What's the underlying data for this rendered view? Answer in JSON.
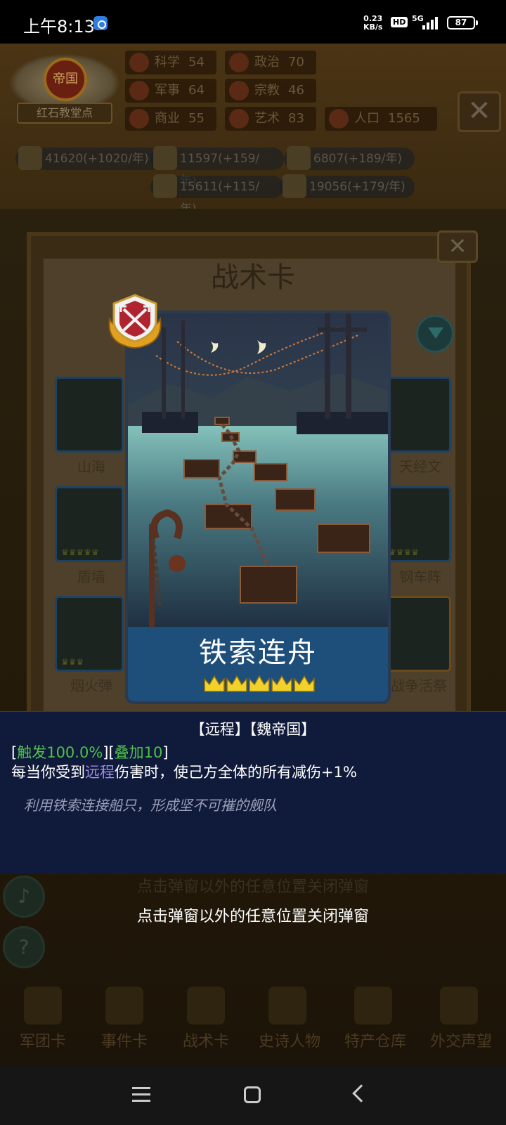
{
  "status_bar": {
    "time": "上午8:13",
    "net_speed_value": "0.23",
    "net_speed_unit": "KB/s",
    "hd_label": "HD",
    "network_label": "5G",
    "battery": "87"
  },
  "empire": {
    "emblem_text": "帝国",
    "name": "红石教堂点"
  },
  "stats": [
    {
      "icon": "science-icon",
      "label": "科学",
      "value": "54"
    },
    {
      "icon": "politics-icon",
      "label": "政治",
      "value": "70"
    },
    {
      "icon": "military-icon",
      "label": "军事",
      "value": "64"
    },
    {
      "icon": "religion-icon",
      "label": "宗教",
      "value": "46"
    },
    {
      "icon": "commerce-icon",
      "label": "商业",
      "value": "55"
    },
    {
      "icon": "art-icon",
      "label": "艺术",
      "value": "83"
    },
    {
      "icon": "population-icon",
      "label": "人口",
      "value": "1565"
    }
  ],
  "resources": [
    {
      "icon": "gold-icon",
      "text": "41620(+1020/年)"
    },
    {
      "icon": "wood-icon",
      "text": "11597(+159/年)"
    },
    {
      "icon": "iron-icon",
      "text": "6807(+189/年)"
    },
    {
      "icon": "stone-icon",
      "text": "15611(+115/年)"
    },
    {
      "icon": "meat-icon",
      "text": "19056(+179/年)"
    }
  ],
  "panel": {
    "title": "战术卡",
    "cards": [
      "山海",
      "天经文",
      "盾墙",
      "钢车阵",
      "烟火弹",
      "战争活祭"
    ]
  },
  "tooltip": {
    "tags": "【远程】【魏帝国】",
    "trigger_open": "[",
    "trigger": "触发100.0%",
    "mid": "][",
    "stack": "叠加10",
    "trigger_close": "]",
    "effect_pre": "每当你受到",
    "effect_keyword": "远程",
    "effect_post": "伤害时，使己方全体的所有减伤+1%",
    "flavor": "利用铁索连接船只，形成坚不可摧的舰队"
  },
  "card": {
    "name": "铁索连舟",
    "stars": 5,
    "badge_icon": "crossed-arrows-icon"
  },
  "close_hint": "点击弹窗以外的任意位置关闭弹窗",
  "bottom_nav": [
    "军团卡",
    "事件卡",
    "战术卡",
    "史诗人物",
    "特产仓库",
    "外交声望"
  ]
}
